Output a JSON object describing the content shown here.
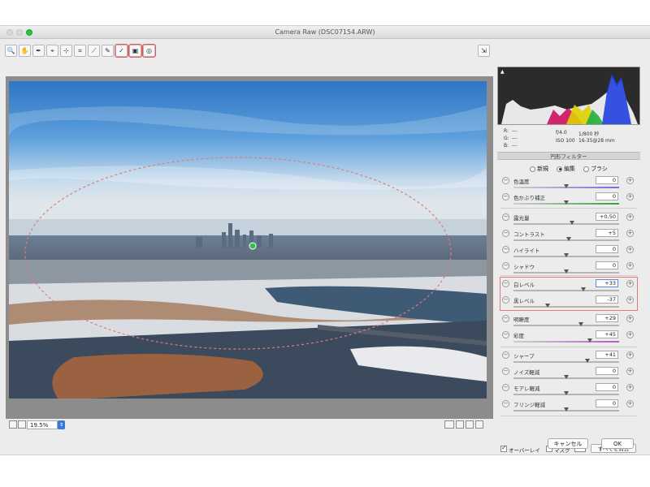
{
  "window": {
    "title": "Camera Raw (DSC07154.ARW)"
  },
  "toolbar": {
    "tools": [
      {
        "name": "zoom-tool",
        "glyph": "🔍"
      },
      {
        "name": "hand-tool",
        "glyph": "✋"
      },
      {
        "name": "white-balance-tool",
        "glyph": "✒"
      },
      {
        "name": "color-sampler-tool",
        "glyph": "⌖"
      },
      {
        "name": "targeted-adjustment-tool",
        "glyph": "⊹"
      },
      {
        "name": "crop-tool",
        "glyph": "⌗"
      },
      {
        "name": "straighten-tool",
        "glyph": "⟋"
      },
      {
        "name": "spot-removal-tool",
        "glyph": "✎"
      },
      {
        "name": "adjustment-brush-tool",
        "glyph": "✓"
      },
      {
        "name": "graduated-filter-tool",
        "glyph": "▣"
      },
      {
        "name": "radial-filter-tool",
        "glyph": "◎"
      }
    ],
    "open_preferences_glyph": "⇲"
  },
  "bottom": {
    "zoom": "19.5%",
    "zoom_arrow": "⇕"
  },
  "histogram": {
    "corner_marker": "▲"
  },
  "exif": {
    "r": "R:",
    "g": "G:",
    "b": "B:",
    "dash": "---",
    "aperture": "f/4.0",
    "shutter": "1/800 秒",
    "iso": "ISO 100",
    "lens": "16-35@28 mm"
  },
  "panel": {
    "title": "円形フィルター",
    "modes": [
      "新規",
      "編集",
      "ブラシ"
    ],
    "rows": [
      {
        "id": "temp",
        "label": "色温度",
        "value": "0",
        "pos": 0.5,
        "color": "#7070e0"
      },
      {
        "id": "tint",
        "label": "色かぶり補正",
        "value": "0",
        "pos": 0.5,
        "color": "#3aa040"
      },
      {
        "id": "exposure",
        "label": "露光量",
        "value": "+0.50",
        "pos": 0.55
      },
      {
        "id": "contrast",
        "label": "コントラスト",
        "value": "+5",
        "pos": 0.52
      },
      {
        "id": "highlights",
        "label": "ハイライト",
        "value": "0",
        "pos": 0.5
      },
      {
        "id": "shadows",
        "label": "シャドウ",
        "value": "0",
        "pos": 0.5
      },
      {
        "id": "whites",
        "label": "白レベル",
        "value": "+33",
        "pos": 0.66,
        "active": true
      },
      {
        "id": "blacks",
        "label": "黒レベル",
        "value": "-37",
        "pos": 0.32
      },
      {
        "id": "clarity",
        "label": "明瞭度",
        "value": "+29",
        "pos": 0.64
      },
      {
        "id": "saturation",
        "label": "彩度",
        "value": "+45",
        "pos": 0.72,
        "color": "#b060c0"
      },
      {
        "id": "sharpness",
        "label": "シャープ",
        "value": "+41",
        "pos": 0.7
      },
      {
        "id": "noise",
        "label": "ノイズ軽減",
        "value": "0",
        "pos": 0.5
      },
      {
        "id": "moire",
        "label": "モアレ軽減",
        "value": "0",
        "pos": 0.5
      },
      {
        "id": "defringe",
        "label": "フリンジ軽減",
        "value": "0",
        "pos": 0.5
      }
    ],
    "overlay_label": "オーバーレイ",
    "mask_label": "マスク",
    "reset_label": "すべてを消去"
  },
  "buttons": {
    "cancel": "キャンセル",
    "ok": "OK"
  }
}
